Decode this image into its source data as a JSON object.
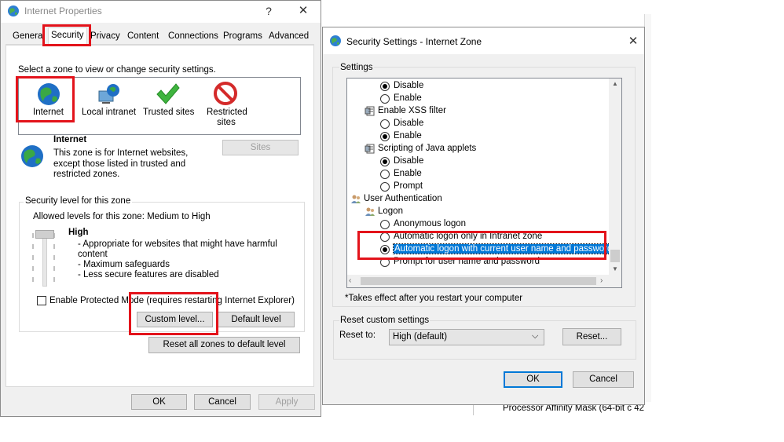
{
  "ip": {
    "title": "Internet Properties",
    "help": "?",
    "close": "✕",
    "tabs": [
      "General",
      "Security",
      "Privacy",
      "Content",
      "Connections",
      "Programs",
      "Advanced"
    ],
    "zone_prompt": "Select a zone to view or change security settings.",
    "zones": [
      "Internet",
      "Local intranet",
      "Trusted sites",
      "Restricted sites"
    ],
    "zone_title": "Internet",
    "zone_desc": [
      "This zone is for Internet websites,",
      "except those listed in trusted and",
      "restricted zones."
    ],
    "sites_button": "Sites",
    "security_level_legend": "Security level for this zone",
    "allowed_levels": "Allowed levels for this zone: Medium to High",
    "level_name": "High",
    "level_bullets": [
      "- Appropriate for websites that might have harmful",
      "  content",
      "- Maximum safeguards",
      "- Less secure features are disabled"
    ],
    "protected_mode_label": "Enable Protected Mode (requires restarting Internet Explorer)",
    "custom_level_button": "Custom level...",
    "default_level_button": "Default level",
    "reset_all_button": "Reset all zones to default level",
    "ok": "OK",
    "cancel": "Cancel",
    "apply": "Apply"
  },
  "ss": {
    "title": "Security Settings - Internet Zone",
    "close": "✕",
    "settings_label": "Settings",
    "tree": [
      {
        "kind": "radio",
        "label": "Disable",
        "on": true
      },
      {
        "kind": "radio",
        "label": "Enable",
        "on": false
      },
      {
        "kind": "group",
        "label": "Enable XSS filter"
      },
      {
        "kind": "radio",
        "label": "Disable",
        "on": false
      },
      {
        "kind": "radio",
        "label": "Enable",
        "on": true
      },
      {
        "kind": "group",
        "label": "Scripting of Java applets"
      },
      {
        "kind": "radio",
        "label": "Disable",
        "on": true
      },
      {
        "kind": "radio",
        "label": "Enable",
        "on": false
      },
      {
        "kind": "radio",
        "label": "Prompt",
        "on": false
      },
      {
        "kind": "category",
        "label": "User Authentication"
      },
      {
        "kind": "sub",
        "label": "Logon"
      },
      {
        "kind": "radio",
        "label": "Anonymous logon",
        "on": false
      },
      {
        "kind": "radio",
        "label": "Automatic logon only in Intranet zone",
        "on": false
      },
      {
        "kind": "radio",
        "label": "Automatic logon with current user name and password",
        "on": true,
        "selected": true
      },
      {
        "kind": "radio",
        "label": "Prompt for user name and password",
        "on": false
      }
    ],
    "note": "*Takes effect after you restart your computer",
    "reset_group_label": "Reset custom settings",
    "reset_to_label": "Reset to:",
    "reset_to_value": "High (default)",
    "reset_button": "Reset...",
    "ok": "OK",
    "cancel": "Cancel"
  },
  "background": {
    "bottom_text": "Processor Affinity Mask (64-bit c 42"
  }
}
